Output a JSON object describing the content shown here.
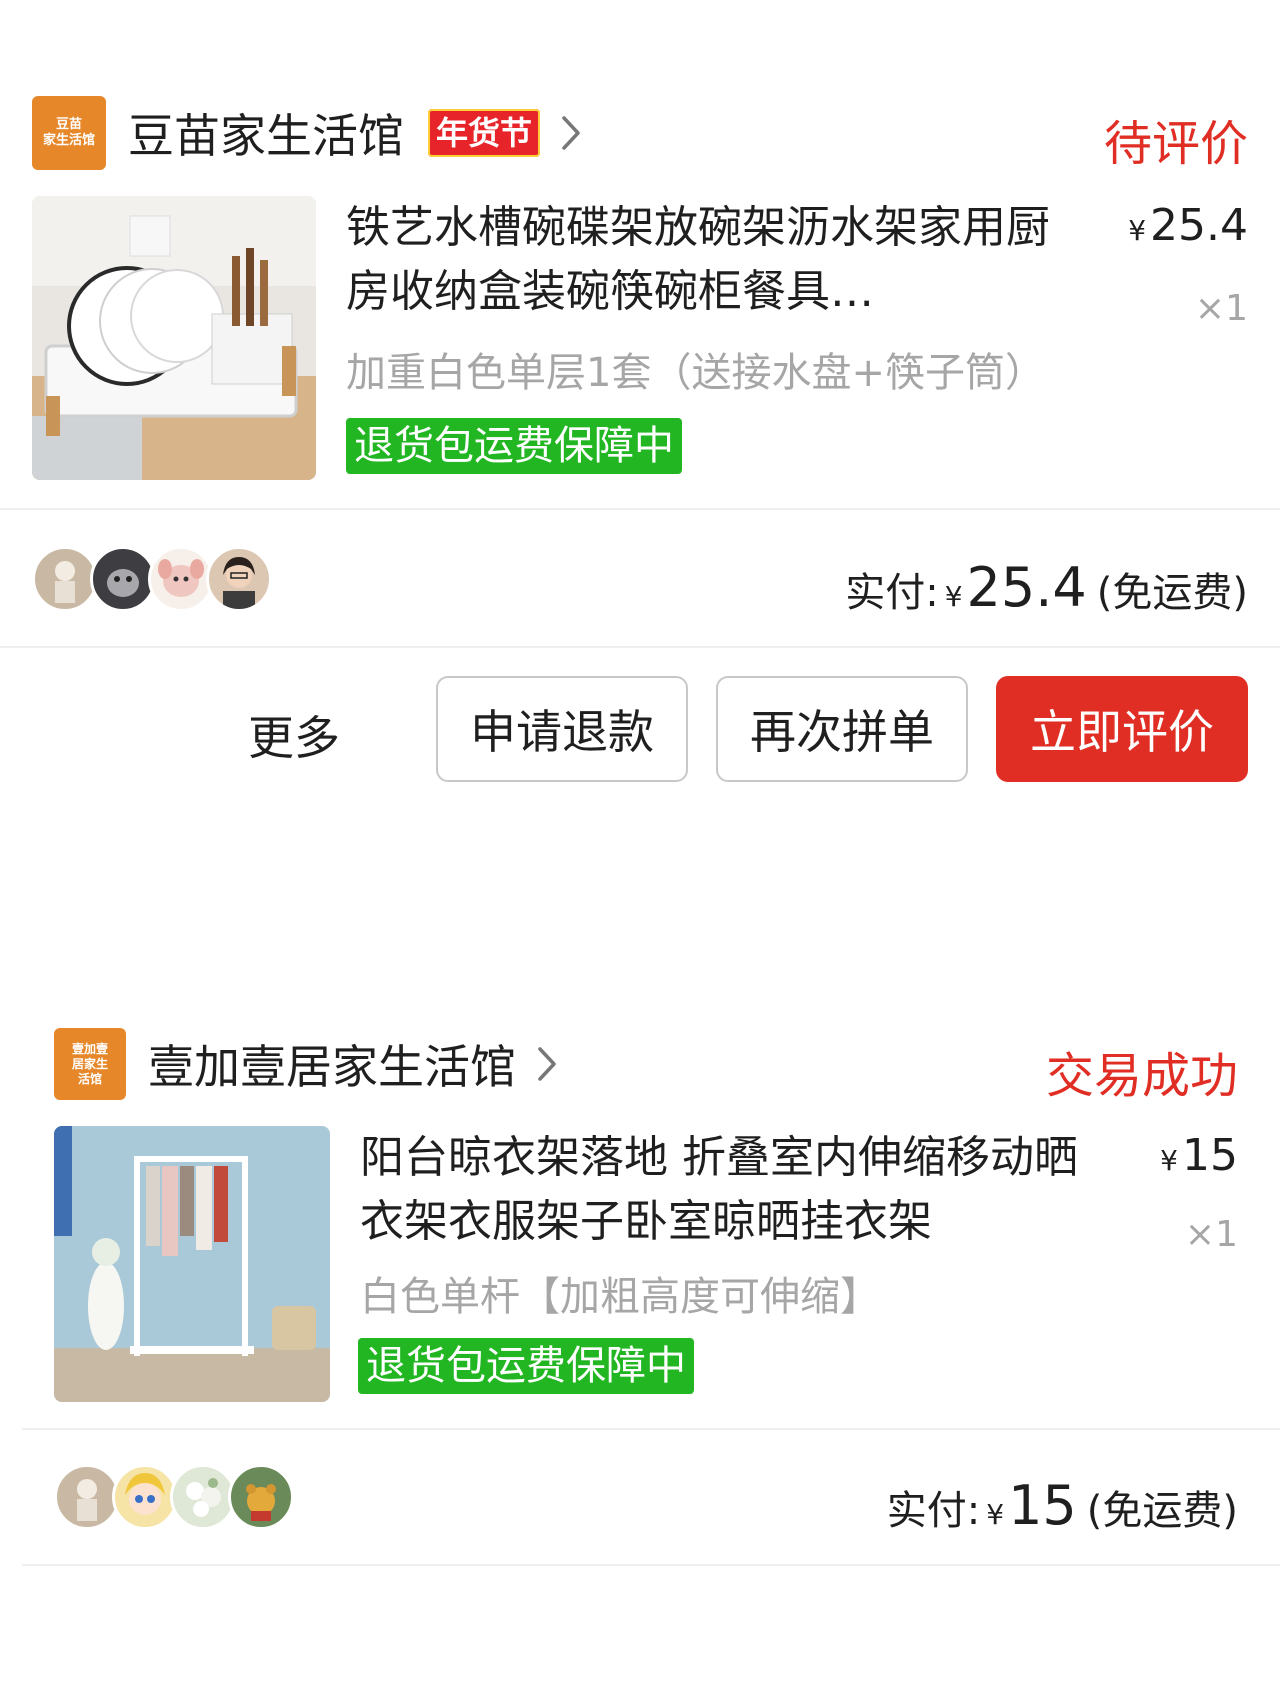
{
  "orders": [
    {
      "shop": {
        "logo_text_line1": "豆苗",
        "logo_text_line2": "家生活馆",
        "name": "豆苗家生活馆",
        "promo_tag": "年货节"
      },
      "status": "待评价",
      "product": {
        "title": "铁艺水槽碗碟架放碗架沥水架家用厨房收纳盒装碗筷碗柜餐具…",
        "spec": "加重白色单层1套（送接水盘+筷子筒）",
        "badge": "退货包运费保障中",
        "currency": "¥",
        "price": "25.4",
        "quantity": "×1"
      },
      "payment": {
        "label": "实付:",
        "currency": "¥",
        "amount": "25.4",
        "shipping_note": "(免运费)"
      },
      "actions": {
        "more": "更多",
        "refund": "申请退款",
        "reorder": "再次拼单",
        "review": "立即评价"
      }
    },
    {
      "shop": {
        "logo_text_line1": "壹加壹",
        "logo_text_line2": "居家生",
        "logo_text_line3": "活馆",
        "name": "壹加壹居家生活馆"
      },
      "status": "交易成功",
      "product": {
        "title": "阳台晾衣架落地  折叠室内伸缩移动晒衣架衣服架子卧室晾晒挂衣架",
        "spec": "白色单杆【加粗高度可伸缩】",
        "badge": "退货包运费保障中",
        "currency": "¥",
        "price": "15",
        "quantity": "×1"
      },
      "payment": {
        "label": "实付:",
        "currency": "¥",
        "amount": "15",
        "shipping_note": "(免运费)"
      }
    }
  ],
  "colors": {
    "accent_red": "#e02e24",
    "badge_green": "#22b722",
    "logo_orange": "#e6872a"
  },
  "icons": [
    "chevron-right-icon",
    "dish-rack-photo",
    "clothes-rack-photo",
    "avatar"
  ]
}
